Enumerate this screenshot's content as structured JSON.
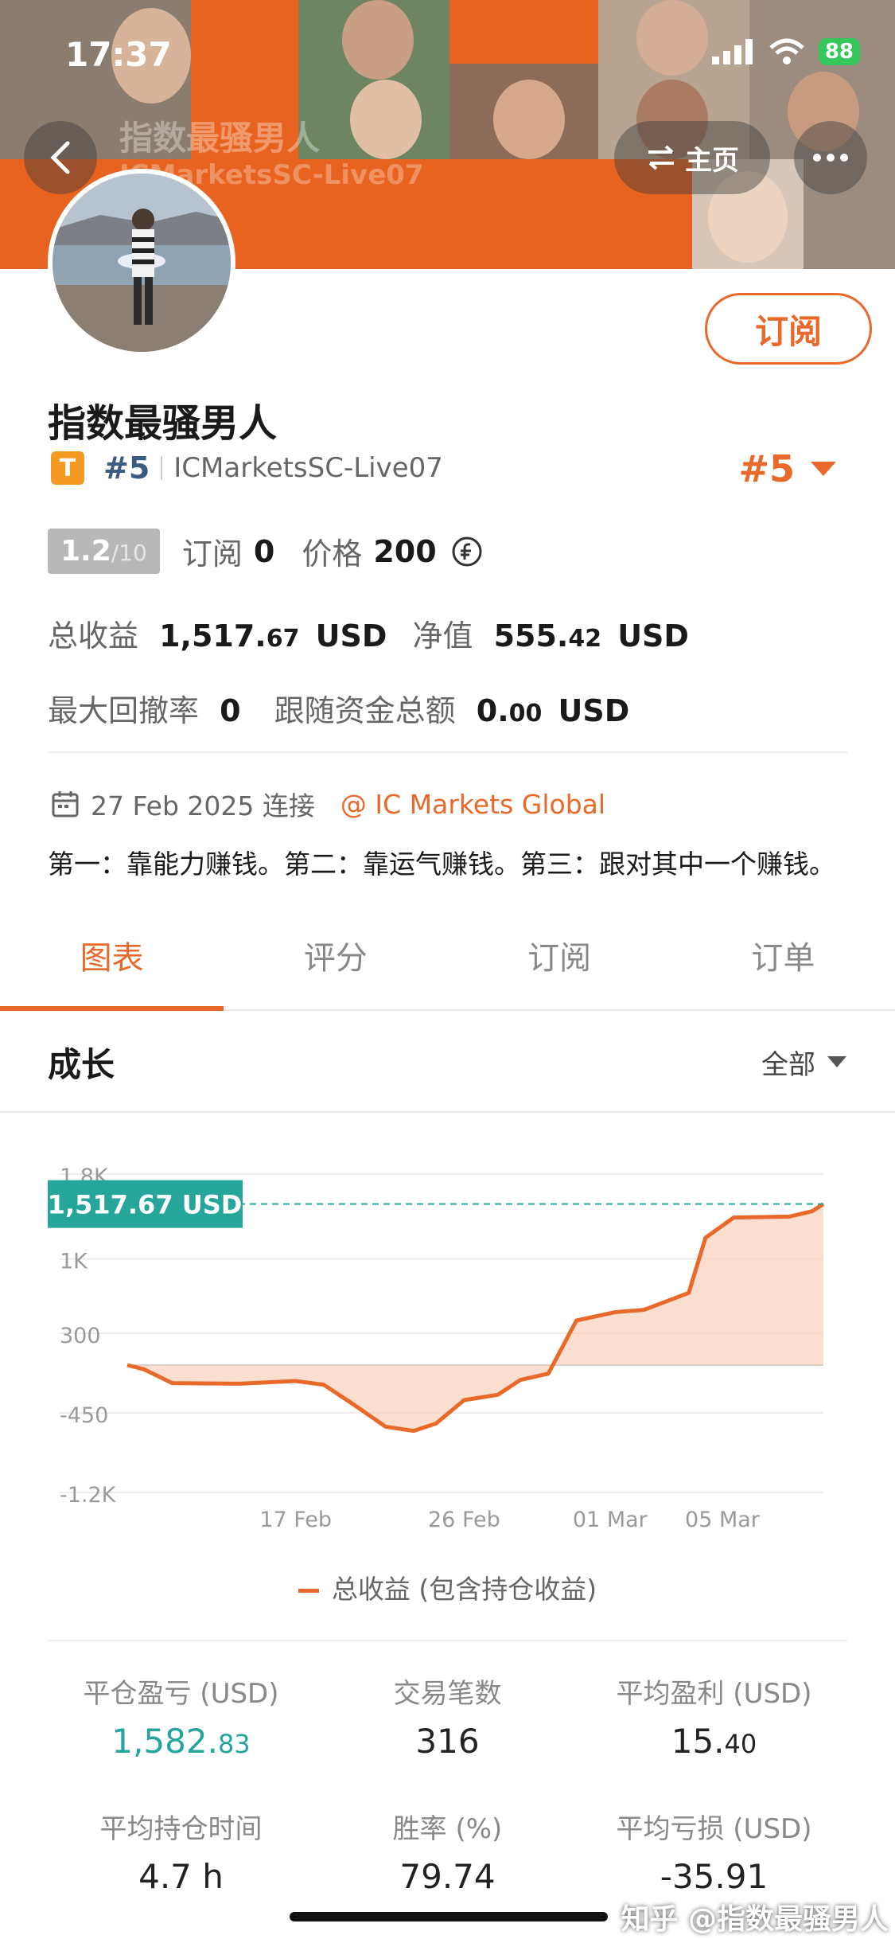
{
  "status_bar": {
    "time": "17:37",
    "battery": "88"
  },
  "header": {
    "home_label": "主页",
    "banner_watermark_name": "指数最骚男人",
    "banner_watermark_account": "ICMarketsSC-Live07"
  },
  "profile": {
    "subscribe_label": "订阅",
    "name": "指数最骚男人",
    "badge": "T",
    "rank_small": "#5",
    "account": "ICMarketsSC-Live07",
    "rank_big": "#5",
    "score": "1.2",
    "score_den": "/10",
    "subscribe_count_label": "订阅",
    "subscribe_count": "0",
    "price_label": "价格",
    "price": "200",
    "total_profit_label": "总收益",
    "total_profit_int": "1,517.",
    "total_profit_dec": "67",
    "total_profit_unit": "USD",
    "equity_label": "净值",
    "equity_int": "555.",
    "equity_dec": "42",
    "equity_unit": "USD",
    "max_drawdown_label": "最大回撤率",
    "max_drawdown": "0",
    "follow_total_label": "跟随资金总额",
    "follow_total_int": "0.",
    "follow_total_dec": "00",
    "follow_total_unit": "USD",
    "connect_date": "27 Feb 2025 连接",
    "broker": "IC Markets Global",
    "bio": "第一：靠能力赚钱。第二：靠运气赚钱。第三：跟对其中一个赚钱。"
  },
  "tabs": [
    "图表",
    "评分",
    "订阅",
    "订单"
  ],
  "section": {
    "title": "成长",
    "filter": "全部"
  },
  "chart_data": {
    "type": "area",
    "y_ticks": [
      "1.8K",
      "1K",
      "300",
      "-450",
      "-1.2K"
    ],
    "y_tick_values": [
      1800,
      1000,
      300,
      -450,
      -1200
    ],
    "x_ticks": [
      "17 Feb",
      "26 Feb",
      "01 Mar",
      "05 Mar"
    ],
    "x_tick_positions": [
      0.3,
      0.6,
      0.86,
      1.06
    ],
    "current_value_label": "1,517.67 USD",
    "current_value": 1517.67,
    "legend": "总收益 (包含持仓收益)",
    "series": [
      {
        "name": "总收益 (包含持仓收益)",
        "points": [
          [
            0,
            0
          ],
          [
            0.03,
            -40
          ],
          [
            0.08,
            -170
          ],
          [
            0.2,
            -175
          ],
          [
            0.3,
            -150
          ],
          [
            0.35,
            -185
          ],
          [
            0.4,
            -360
          ],
          [
            0.46,
            -580
          ],
          [
            0.51,
            -620
          ],
          [
            0.55,
            -550
          ],
          [
            0.6,
            -330
          ],
          [
            0.66,
            -280
          ],
          [
            0.7,
            -140
          ],
          [
            0.75,
            -80
          ],
          [
            0.8,
            420
          ],
          [
            0.87,
            500
          ],
          [
            0.92,
            520
          ],
          [
            0.97,
            620
          ],
          [
            1.0,
            680
          ],
          [
            1.03,
            1200
          ],
          [
            1.08,
            1390
          ],
          [
            1.18,
            1400
          ],
          [
            1.22,
            1450
          ],
          [
            1.24,
            1517.67
          ]
        ]
      }
    ],
    "colors": {
      "line": "#e8692a",
      "fill": "#f6c9b0",
      "label_bg": "#26a69a"
    }
  },
  "stats": [
    {
      "label": "平仓盈亏 (USD)",
      "int": "1,582.",
      "dec": "83",
      "color": "green"
    },
    {
      "label": "交易笔数",
      "int": "316",
      "dec": "",
      "color": "normal"
    },
    {
      "label": "平均盈利 (USD)",
      "int": "15.",
      "dec": "40",
      "color": "normal"
    },
    {
      "label": "平均持仓时间",
      "int": "4.7 h",
      "dec": "",
      "color": "normal"
    },
    {
      "label": "胜率 (%)",
      "int": "79.74",
      "dec": "",
      "color": "normal"
    },
    {
      "label": "平均亏损 (USD)",
      "int": "-35.91",
      "dec": "",
      "color": "normal"
    }
  ],
  "watermark": "知乎 @指数最骚男人"
}
